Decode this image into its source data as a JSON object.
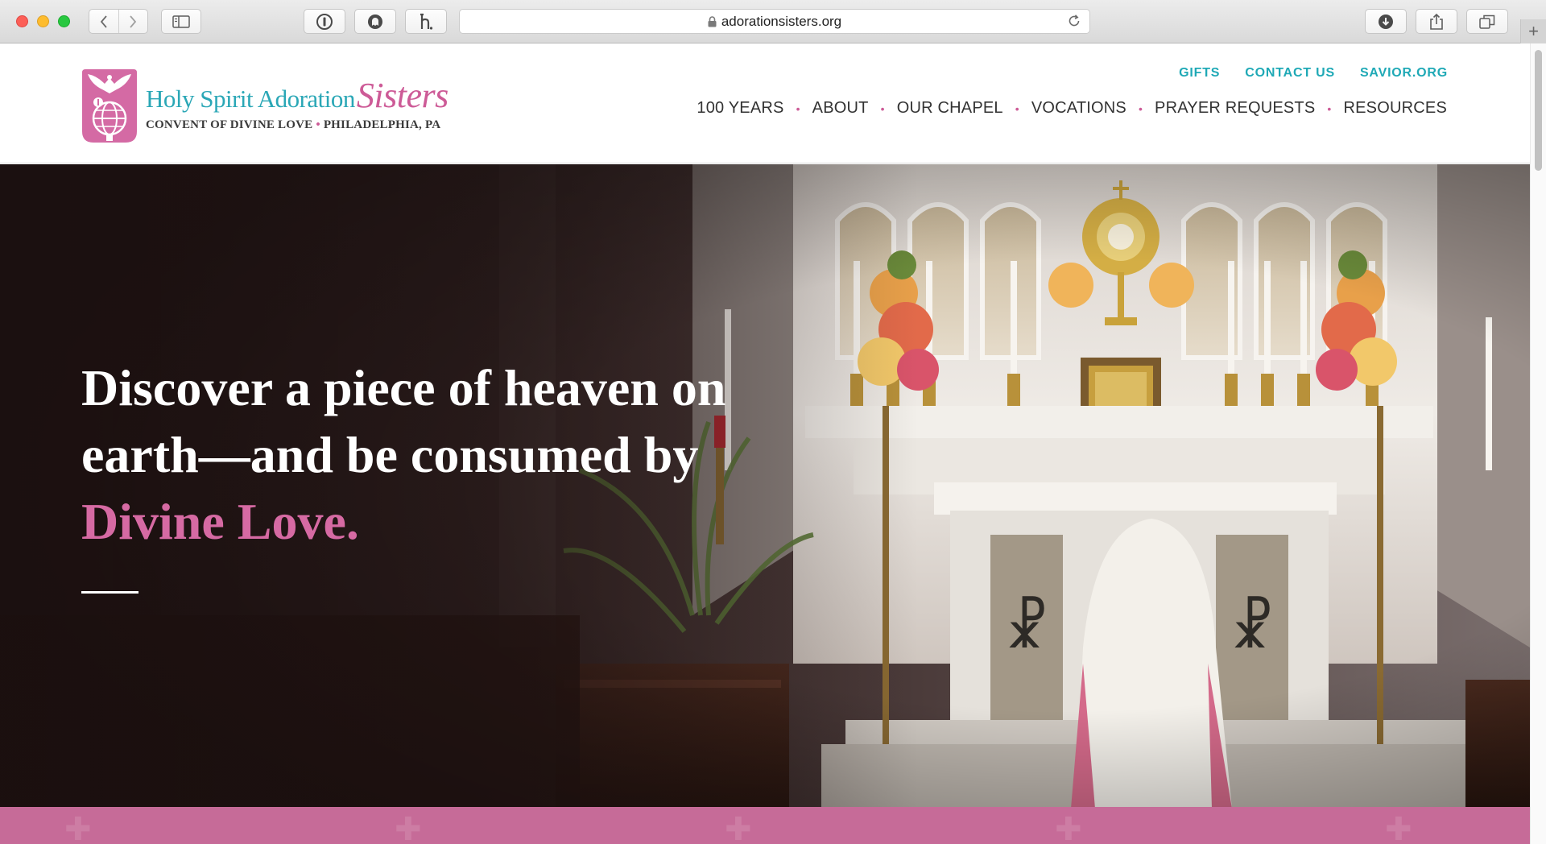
{
  "browser": {
    "url": "adorationsisters.org"
  },
  "site": {
    "logo": {
      "name_main": "Holy Spirit Adoration",
      "name_script": "Sisters",
      "tagline_left": "CONVENT OF DIVINE LOVE",
      "tagline_right": "PHILADELPHIA, PA"
    },
    "utility_nav": [
      "GIFTS",
      "CONTACT US",
      "SAVIOR.ORG"
    ],
    "main_nav": [
      "100 YEARS",
      "ABOUT",
      "OUR CHAPEL",
      "VOCATIONS",
      "PRAYER REQUESTS",
      "RESOURCES"
    ]
  },
  "hero": {
    "line1": "Discover a piece of heaven on",
    "line2": "earth—and be consumed by",
    "accent": "Divine Love."
  },
  "colors": {
    "brand_pink": "#c66b98",
    "brand_teal": "#1fa9b6",
    "accent_pink_text": "#d66aa3"
  }
}
